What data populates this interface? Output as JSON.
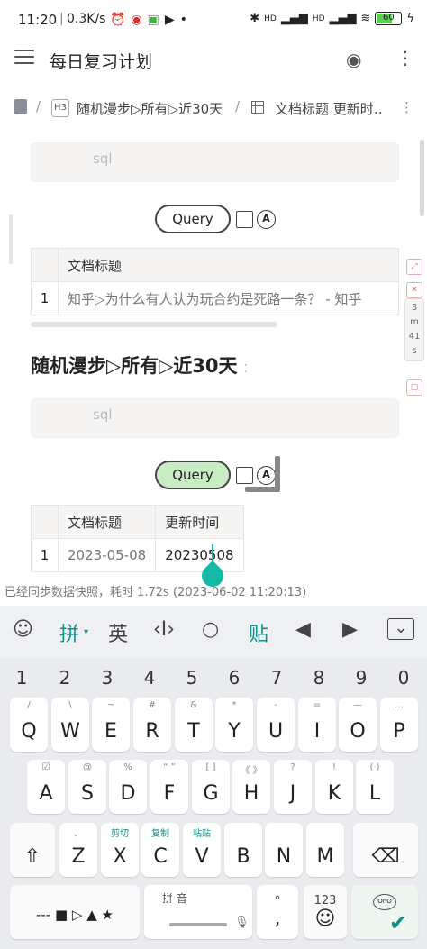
{
  "status_bar": {
    "time": "11:20",
    "net_speed": "0.3K/s",
    "signal1": "HD",
    "signal2": "HD",
    "battery": "60"
  },
  "app_bar": {
    "title": "每日复习计划"
  },
  "breadcrumb": {
    "sep": "/",
    "h3_label": "H3",
    "item1": "随机漫步▷所有▷近30天",
    "item2": "文档标题 更新时‥"
  },
  "block1": {
    "sql_placeholder": "sql",
    "query_label": "Query",
    "auto_label": "A",
    "columns": [
      "文档标题"
    ],
    "rows": [
      {
        "idx": "1",
        "title": "知乎▷为什么有人认为玩合约是死路一条？ - 知乎"
      }
    ]
  },
  "heading": "随机漫步▷所有▷近30天",
  "heading_dots": "⁚",
  "block2": {
    "sql_placeholder": "sql",
    "query_label": "Query",
    "auto_label": "A",
    "columns": [
      "文档标题",
      "更新时间"
    ],
    "rows": [
      {
        "idx": "1",
        "title": "2023-05-08",
        "updated": "20230508"
      }
    ]
  },
  "side_widget": {
    "top_icon": "⤢",
    "close_icon": "✕",
    "timer_lines": [
      "3",
      "m",
      "41",
      "s"
    ],
    "bottom_icon": "▢"
  },
  "sync_status": "已经同步数据快照，耗时 1.72s (2023-06-02 11:20:13)",
  "keyboard_toolbar": {
    "emoji": "☺",
    "pinyin": "拼",
    "english": "英",
    "cursor": "‹I›",
    "search": "○",
    "paste": "贴",
    "left": "◀",
    "right": "▶",
    "collapse": "⌄"
  },
  "keyboard": {
    "numbers": [
      "1",
      "2",
      "3",
      "4",
      "5",
      "6",
      "7",
      "8",
      "9",
      "0"
    ],
    "row1": [
      {
        "k": "Q",
        "s": "/"
      },
      {
        "k": "W",
        "s": "\\"
      },
      {
        "k": "E",
        "s": "~"
      },
      {
        "k": "R",
        "s": "#"
      },
      {
        "k": "T",
        "s": "&"
      },
      {
        "k": "Y",
        "s": "*"
      },
      {
        "k": "U",
        "s": "-"
      },
      {
        "k": "I",
        "s": "="
      },
      {
        "k": "O",
        "s": "—"
      },
      {
        "k": "P",
        "s": "…"
      }
    ],
    "row2": [
      {
        "k": "A",
        "s": "☑"
      },
      {
        "k": "S",
        "s": "@"
      },
      {
        "k": "D",
        "s": "%"
      },
      {
        "k": "F",
        "s": "“ ”"
      },
      {
        "k": "G",
        "s": "[ ]"
      },
      {
        "k": "H",
        "s": "《 》"
      },
      {
        "k": "J",
        "s": "?"
      },
      {
        "k": "K",
        "s": "!"
      },
      {
        "k": "L",
        "s": "( )"
      }
    ],
    "row3": [
      {
        "k": "Z",
        "s": "、"
      },
      {
        "k": "X",
        "s": "剪切"
      },
      {
        "k": "C",
        "s": "复制"
      },
      {
        "k": "V",
        "s": "粘贴"
      },
      {
        "k": "B",
        "s": ""
      },
      {
        "k": "N",
        "s": ""
      },
      {
        "k": "M",
        "s": ""
      }
    ],
    "shift": "⇧",
    "backspace": "⌫",
    "bottom_left": "--- ■ ▷ ▲ ★",
    "space_label": "拼 音",
    "space_mic": "🎙",
    "period": "°",
    "comma": ",",
    "num_label": "123",
    "num_emoji": "☺",
    "enter": "✔"
  }
}
